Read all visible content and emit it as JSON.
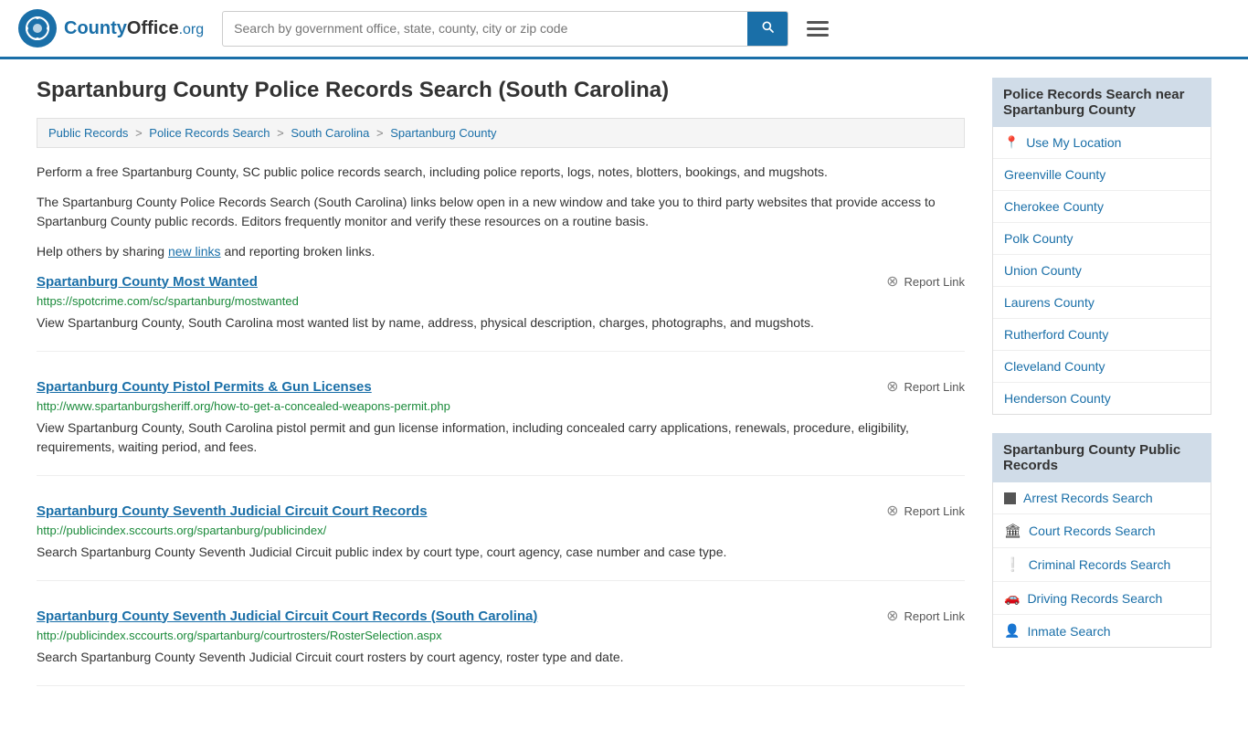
{
  "header": {
    "logo_text": "CountyOffice",
    "logo_org": ".org",
    "search_placeholder": "Search by government office, state, county, city or zip code",
    "search_btn_label": "🔍"
  },
  "page": {
    "title": "Spartanburg County Police Records Search (South Carolina)",
    "breadcrumb": [
      {
        "label": "Public Records",
        "href": "#"
      },
      {
        "label": "Police Records Search",
        "href": "#"
      },
      {
        "label": "South Carolina",
        "href": "#"
      },
      {
        "label": "Spartanburg County",
        "href": "#"
      }
    ],
    "description1": "Perform a free Spartanburg County, SC public police records search, including police reports, logs, notes, blotters, bookings, and mugshots.",
    "description2": "The Spartanburg County Police Records Search (South Carolina) links below open in a new window and take you to third party websites that provide access to Spartanburg County public records. Editors frequently monitor and verify these resources on a routine basis.",
    "description3": "Help others by sharing",
    "new_links_text": "new links",
    "description3_end": " and reporting broken links."
  },
  "results": [
    {
      "title": "Spartanburg County Most Wanted",
      "url": "https://spotcrime.com/sc/spartanburg/mostwanted",
      "desc": "View Spartanburg County, South Carolina most wanted list by name, address, physical description, charges, photographs, and mugshots.",
      "report_label": "Report Link"
    },
    {
      "title": "Spartanburg County Pistol Permits & Gun Licenses",
      "url": "http://www.spartanburgsheriff.org/how-to-get-a-concealed-weapons-permit.php",
      "desc": "View Spartanburg County, South Carolina pistol permit and gun license information, including concealed carry applications, renewals, procedure, eligibility, requirements, waiting period, and fees.",
      "report_label": "Report Link"
    },
    {
      "title": "Spartanburg County Seventh Judicial Circuit Court Records",
      "url": "http://publicindex.sccourts.org/spartanburg/publicindex/",
      "desc": "Search Spartanburg County Seventh Judicial Circuit public index by court type, court agency, case number and case type.",
      "report_label": "Report Link"
    },
    {
      "title": "Spartanburg County Seventh Judicial Circuit Court Records (South Carolina)",
      "url": "http://publicindex.sccourts.org/spartanburg/courtrosters/RosterSelection.aspx",
      "desc": "Search Spartanburg County Seventh Judicial Circuit court rosters by court agency, roster type and date.",
      "report_label": "Report Link"
    }
  ],
  "sidebar": {
    "nearby_title": "Police Records Search near Spartanburg County",
    "use_location": "Use My Location",
    "nearby_counties": [
      "Greenville County",
      "Cherokee County",
      "Polk County",
      "Union County",
      "Laurens County",
      "Rutherford County",
      "Cleveland County",
      "Henderson County"
    ],
    "public_records_title": "Spartanburg County Public Records",
    "public_records": [
      {
        "label": "Arrest Records Search",
        "icon": "square"
      },
      {
        "label": "Court Records Search",
        "icon": "pillars"
      },
      {
        "label": "Criminal Records Search",
        "icon": "exclaim"
      },
      {
        "label": "Driving Records Search",
        "icon": "car"
      },
      {
        "label": "Inmate Search",
        "icon": "person"
      }
    ]
  }
}
